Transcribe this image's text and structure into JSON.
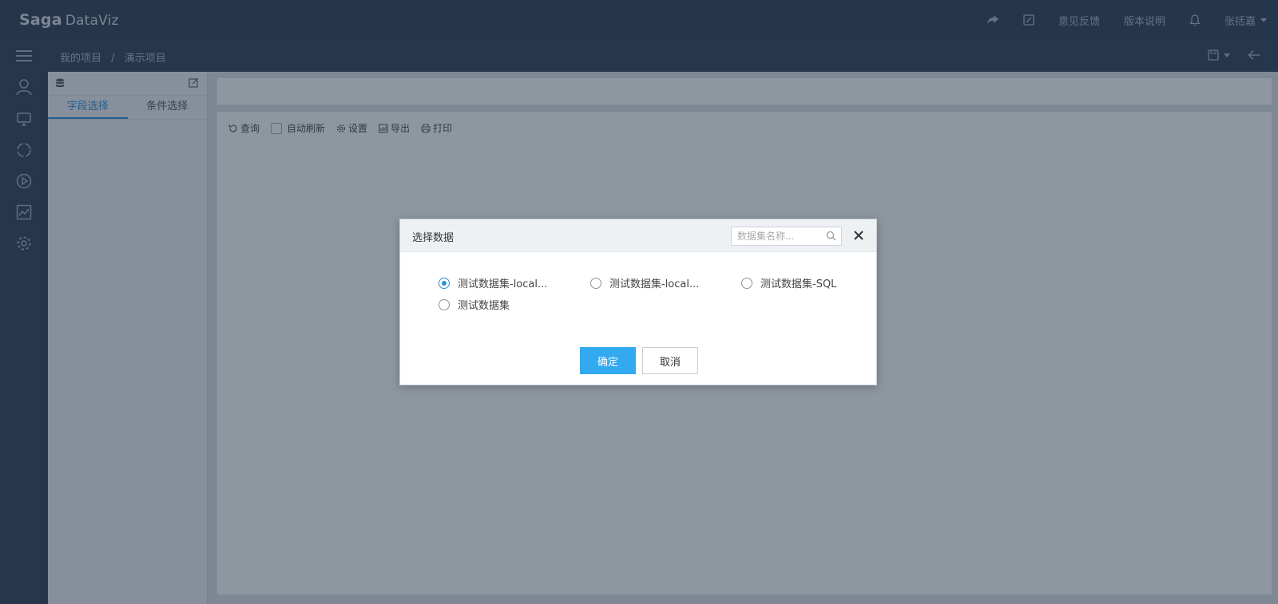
{
  "header": {
    "brand": "Saga",
    "product": "DataViz",
    "feedback": "意见反馈",
    "release_notes": "版本说明",
    "user": "张括嘉"
  },
  "breadcrumb": {
    "items": [
      "我的项目",
      "演示项目"
    ],
    "separator": "/"
  },
  "left_panel": {
    "tabs": [
      "字段选择",
      "条件选择"
    ],
    "active_tab": 0
  },
  "toolbar": {
    "query": "查询",
    "auto_refresh": "自动刷新",
    "settings": "设置",
    "export": "导出",
    "print": "打印"
  },
  "dialog": {
    "title": "选择数据",
    "search_placeholder": "数据集名称...",
    "options": [
      {
        "label": "测试数据集-local...",
        "checked": true
      },
      {
        "label": "测试数据集-local...",
        "checked": false
      },
      {
        "label": "测试数据集-SQL",
        "checked": false
      },
      {
        "label": "测试数据集",
        "checked": false
      }
    ],
    "ok_label": "确定",
    "cancel_label": "取消"
  },
  "colors": {
    "accent": "#2d8fd5",
    "primary_button": "#33aaf0",
    "header_bg": "#2c3e55"
  }
}
